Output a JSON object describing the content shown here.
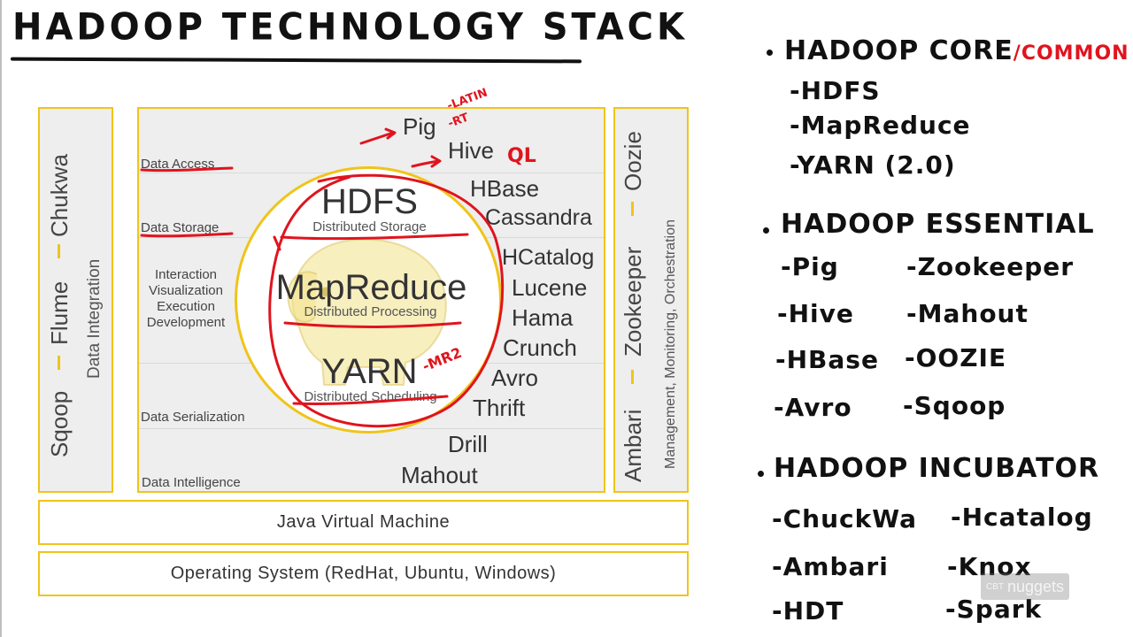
{
  "title": "HADOOP TECHNOLOGY STACK",
  "stack": {
    "left_panel": {
      "tools": [
        "Sqoop",
        "Flume",
        "Chukwa"
      ],
      "label": "Data Integration"
    },
    "right_panel": {
      "tools": [
        "Ambari",
        "Zookeeper",
        "Oozie"
      ],
      "label": "Management, Monitoring, Orchestration"
    },
    "categories": {
      "data_access": "Data Access",
      "data_storage": "Data Storage",
      "interaction": [
        "Interaction",
        "Visualization",
        "Execution",
        "Development"
      ],
      "data_serialization": "Data Serialization",
      "data_intelligence": "Data Intelligence"
    },
    "technologies": [
      "Pig",
      "Hive",
      "HBase",
      "Cassandra",
      "HCatalog",
      "Lucene",
      "Hama",
      "Crunch",
      "Avro",
      "Thrift",
      "Drill",
      "Mahout"
    ],
    "core": [
      {
        "name": "HDFS",
        "desc": "Distributed Storage"
      },
      {
        "name": "MapReduce",
        "desc": "Distributed Processing"
      },
      {
        "name": "YARN",
        "desc": "Distributed Scheduling"
      }
    ],
    "jvm": "Java Virtual Machine",
    "os": "Operating System (RedHat, Ubuntu, Windows)"
  },
  "annotations": {
    "pig_note": [
      "-LATIN",
      "-RT"
    ],
    "hive_note": "QL",
    "yarn_note": "-MR2",
    "ink_color": "#e0141e"
  },
  "notes": {
    "core": {
      "heading": "HADOOP CORE",
      "heading_suffix": "/COMMON",
      "items": [
        "-HDFS",
        "-MapReduce",
        "-YARN (2.0)"
      ]
    },
    "essential": {
      "heading": "HADOOP ESSENTIAL",
      "left": [
        "-Pig",
        "-Hive",
        "-HBase",
        "-Avro"
      ],
      "right": [
        "-Zookeeper",
        "-Mahout",
        "-OOZIE",
        "-Sqoop"
      ]
    },
    "incubator": {
      "heading": "HADOOP INCUBATOR",
      "left": [
        "-ChuckWa",
        "-Ambari",
        "-HDT"
      ],
      "right": [
        "-Hcatalog",
        "-Knox",
        "-Spark"
      ]
    }
  },
  "watermark": {
    "small": "CBT",
    "brand": "nuggets"
  },
  "colors": {
    "panel_border": "#f0c419",
    "panel_fill": "#eeeeee",
    "ink_red": "#e0141e"
  }
}
